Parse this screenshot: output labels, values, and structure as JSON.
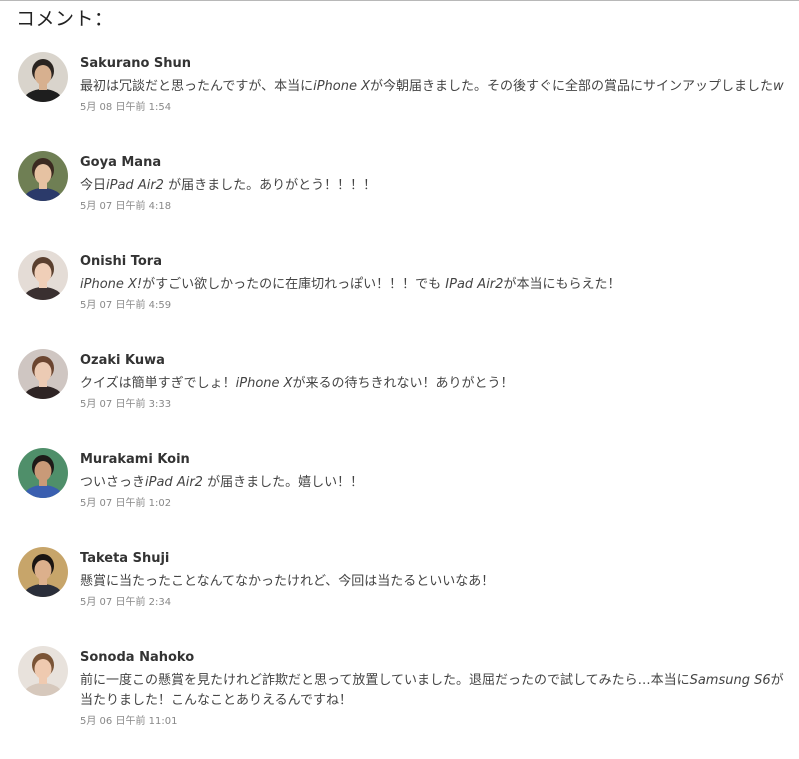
{
  "page": {
    "heading": "コメント："
  },
  "comments": [
    {
      "name": "Sakurano Shun",
      "text": [
        {
          "t": "最初は冗談だと思ったんですが、本当に"
        },
        {
          "t": "iPhone X",
          "i": true
        },
        {
          "t": "が今朝届きました。その後すぐに全部の賞品にサインアップしました"
        },
        {
          "t": "w",
          "i": true
        }
      ],
      "time": "5月 08 日午前 1:54",
      "avatar": {
        "bg": "#d9d4cc",
        "skin": "#d7b08f",
        "hair": "#2a2420",
        "shirt": "#1e1e1e"
      }
    },
    {
      "name": "Goya Mana",
      "text": [
        {
          "t": "今日"
        },
        {
          "t": "iPad Air2",
          "i": true
        },
        {
          "t": " が届きました。ありがとう！！！！"
        }
      ],
      "time": "5月 07 日午前 4:18",
      "avatar": {
        "bg": "#6f7f54",
        "skin": "#e6c2a2",
        "hair": "#3b2a20",
        "shirt": "#2b3a6a"
      }
    },
    {
      "name": "Onishi Tora",
      "text": [
        {
          "t": "iPhone X!",
          "i": true
        },
        {
          "t": "がすごい欲しかったのに在庫切れっぽい！！！でも "
        },
        {
          "t": "IPad Air2",
          "i": true
        },
        {
          "t": "が本当にもらえた！"
        }
      ],
      "time": "5月 07 日午前 4:59",
      "avatar": {
        "bg": "#e4dcd6",
        "skin": "#f0cfb8",
        "hair": "#5a3f2e",
        "shirt": "#3a3030"
      }
    },
    {
      "name": "Ozaki Kuwa",
      "text": [
        {
          "t": "クイズは簡単すぎでしょ！"
        },
        {
          "t": "iPhone X",
          "i": true
        },
        {
          "t": "が来るの待ちきれない！ありがとう！"
        }
      ],
      "time": "5月 07 日午前 3:33",
      "avatar": {
        "bg": "#cfc6c2",
        "skin": "#eccbb4",
        "hair": "#6b4530",
        "shirt": "#2e2424"
      }
    },
    {
      "name": "Murakami Koin",
      "text": [
        {
          "t": "ついさっき"
        },
        {
          "t": "iPad Air2",
          "i": true
        },
        {
          "t": " が届きました。嬉しい！！"
        }
      ],
      "time": "5月 07 日午前 1:02",
      "avatar": {
        "bg": "#4f8f6a",
        "skin": "#c99a78",
        "hair": "#1e1a18",
        "shirt": "#3a5fb0"
      }
    },
    {
      "name": "Taketa Shuji",
      "text": [
        {
          "t": "懸賞に当たったことなんてなかったけれど、今回は当たるといいなあ！"
        }
      ],
      "time": "5月 07 日午前 2:34",
      "avatar": {
        "bg": "#c7a56a",
        "skin": "#dcb08c",
        "hair": "#1a1512",
        "shirt": "#2a2e3a"
      }
    },
    {
      "name": "Sonoda Nahoko",
      "text": [
        {
          "t": "前に一度この懸賞を見たけれど詐欺だと思って放置していました。退屈だったので試してみたら…本当に"
        },
        {
          "t": "Samsung S6",
          "i": true
        },
        {
          "t": "が当たりました！こんなことありえるんですね！"
        }
      ],
      "time": "5月 06 日午前 11:01",
      "avatar": {
        "bg": "#e8e2dc",
        "skin": "#efcab0",
        "hair": "#7a5436",
        "shirt": "#d6c8bc"
      }
    }
  ]
}
